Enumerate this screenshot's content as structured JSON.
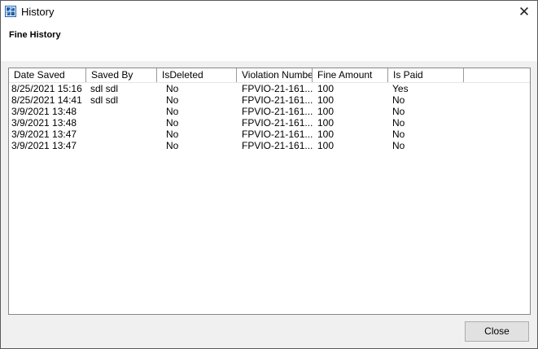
{
  "window": {
    "title": "History",
    "icon": "app-grid-icon",
    "close_glyph": "✕"
  },
  "header": {
    "title": "Fine History"
  },
  "table": {
    "columns": [
      "Date Saved",
      "Saved By",
      "IsDeleted",
      "Violation Number",
      "Fine Amount",
      "Is Paid"
    ],
    "rows": [
      [
        "8/25/2021 15:16",
        "sdl sdl",
        "No",
        "FPVIO-21-161...",
        "100",
        "Yes"
      ],
      [
        "8/25/2021 14:41",
        "sdl sdl",
        "No",
        "FPVIO-21-161...",
        "100",
        "No"
      ],
      [
        "3/9/2021 13:48",
        "",
        "No",
        "FPVIO-21-161...",
        "100",
        "No"
      ],
      [
        "3/9/2021 13:48",
        "",
        "No",
        "FPVIO-21-161...",
        "100",
        "No"
      ],
      [
        "3/9/2021 13:47",
        "",
        "No",
        "FPVIO-21-161...",
        "100",
        "No"
      ],
      [
        "3/9/2021 13:47",
        "",
        "No",
        "FPVIO-21-161...",
        "100",
        "No"
      ]
    ]
  },
  "footer": {
    "close_label": "Close"
  },
  "colors": {
    "accent": "#1f5fa8",
    "window_bg": "#f0f0f0"
  }
}
